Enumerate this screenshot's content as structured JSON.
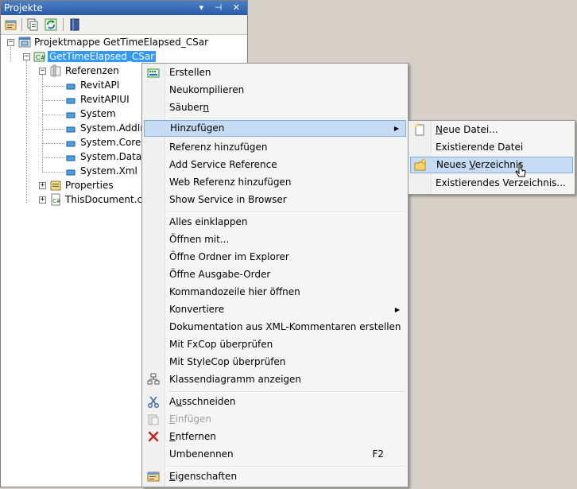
{
  "panel": {
    "title": "Projekte",
    "controls": "▾ ⊣ ✕"
  },
  "tree": {
    "solution": "Projektmappe GetTimeElapsed_CSar",
    "project": "GetTimeElapsed_CSar",
    "references_label": "Referenzen",
    "references": [
      "RevitAPI",
      "RevitAPIUI",
      "System",
      "System.AddIn",
      "System.Core",
      "System.Data",
      "System.Xml"
    ],
    "properties": "Properties",
    "document": "ThisDocument.cs"
  },
  "context_menu": {
    "items": [
      {
        "label": "Erstellen"
      },
      {
        "label": "Neukompilieren"
      },
      {
        "label_pre": "Säuber",
        "label_u": "n",
        "label_post": ""
      },
      {
        "label": "Hinzufügen"
      },
      {
        "label": "Referenz hinzufügen"
      },
      {
        "label": "Add Service Reference"
      },
      {
        "label": "Web Referenz hinzufügen"
      },
      {
        "label": "Show Service in Browser"
      },
      {
        "label": "Alles einklappen"
      },
      {
        "label": "Öffnen mit..."
      },
      {
        "label": "Öffne Ordner im Explorer"
      },
      {
        "label": "Öffne Ausgabe-Order"
      },
      {
        "label": "Kommandozeile hier öffnen"
      },
      {
        "label": "Konvertiere"
      },
      {
        "label": "Dokumentation aus XML-Kommentaren erstellen"
      },
      {
        "label": "Mit FxCop überprüfen"
      },
      {
        "label": "Mit StyleCop überprüfen"
      },
      {
        "label": "Klassendiagramm anzeigen"
      },
      {
        "label_pre": "A",
        "label_u": "u",
        "label_post": "sschneiden"
      },
      {
        "label_pre": "",
        "label_u": "E",
        "label_post": "infügen"
      },
      {
        "label_pre": "",
        "label_u": "E",
        "label_post": "ntfernen"
      },
      {
        "label": "Umbenennen",
        "shortcut": "F2"
      },
      {
        "label_pre": "",
        "label_u": "E",
        "label_post": "igenschaften"
      }
    ]
  },
  "submenu": {
    "items": [
      {
        "label_pre": "",
        "label_u": "N",
        "label_post": "eue Datei..."
      },
      {
        "label": "Existierende Datei"
      },
      {
        "label_pre": "Neues ",
        "label_u": "V",
        "label_post": "erzeichnis"
      },
      {
        "label": "Existierendes Verzeichnis..."
      }
    ]
  },
  "colors": {
    "selection": "#3399ff",
    "menu_highlight": "#c6dcf4",
    "menu_highlight_border": "#84acdd"
  }
}
